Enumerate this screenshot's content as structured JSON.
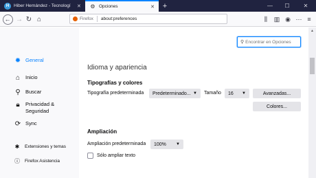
{
  "tabs": [
    {
      "label": "Hiber Hernández - Tecnologí",
      "active": false
    },
    {
      "label": "Opciones",
      "active": true
    }
  ],
  "window_controls": {
    "minimize": "—",
    "maximize": "☐",
    "close": "✕"
  },
  "urlbar": {
    "identity": "Firefox",
    "url": "about:preferences"
  },
  "search": {
    "placeholder": "Encontrar en Opciones"
  },
  "sidebar": {
    "categories": [
      {
        "label": "General",
        "icon": "gear-icon",
        "selected": true
      },
      {
        "label": "Inicio",
        "icon": "home-icon"
      },
      {
        "label": "Buscar",
        "icon": "search-icon"
      },
      {
        "label": "Privacidad & Seguridad",
        "icon": "lock-icon"
      },
      {
        "label": "Sync",
        "icon": "sync-icon"
      }
    ],
    "footer": [
      {
        "label": "Extensiones y temas",
        "icon": "puzzle-icon"
      },
      {
        "label": "Firefox Asistencia",
        "icon": "help-icon"
      }
    ]
  },
  "main": {
    "section_title": "Idioma y apariencia",
    "fonts": {
      "heading": "Tipografías y colores",
      "default_font_label": "Tipografía predeterminada",
      "default_font_value": "Predeterminado...",
      "size_label": "Tamaño",
      "size_value": "16",
      "advanced_button": "Avanzadas...",
      "colors_button": "Colores..."
    },
    "zoom": {
      "heading": "Ampliación",
      "default_zoom_label": "Ampliación predeterminada",
      "default_zoom_value": "100%",
      "text_only_label": "Sólo ampliar texto",
      "text_only_checked": false
    }
  },
  "colors": {
    "accent": "#0a84ff",
    "titlebar": "#202340"
  }
}
